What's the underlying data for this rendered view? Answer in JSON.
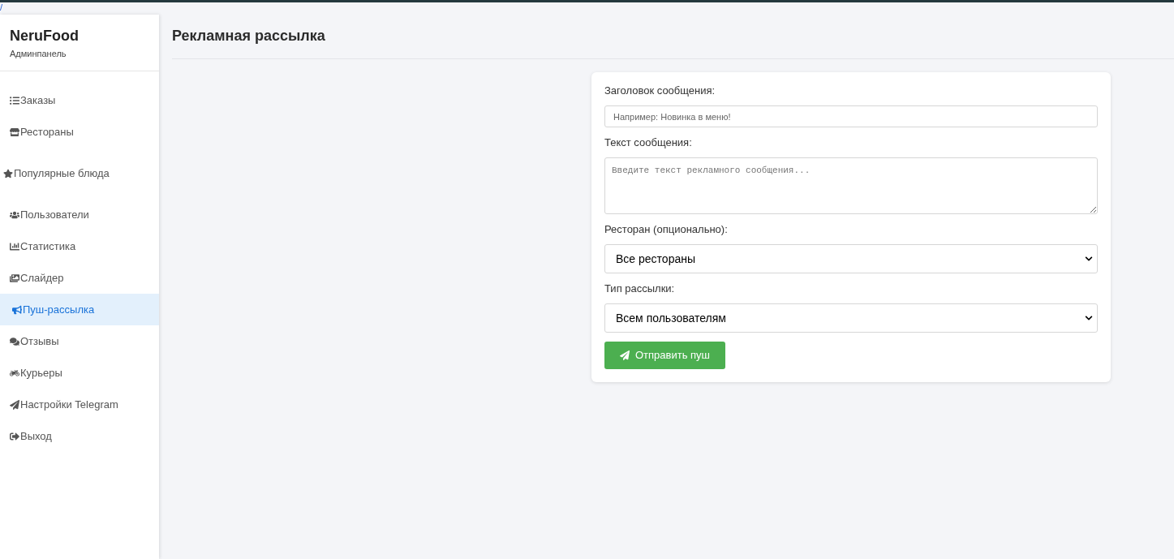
{
  "top_fragment": "/",
  "sidebar": {
    "brand": "NeruFood",
    "subtitle": "Админпанель",
    "items": [
      {
        "label": "Заказы",
        "kind": "nav",
        "selected": false
      },
      {
        "label": "Рестораны",
        "kind": "nav",
        "selected": false
      },
      {
        "label": "Популярные блюда",
        "kind": "block",
        "selected": false
      },
      {
        "label": "Пользователи",
        "kind": "nav",
        "selected": false
      },
      {
        "label": "Статистика",
        "kind": "nav",
        "selected": false
      },
      {
        "label": "Слайдер",
        "kind": "nav",
        "selected": false
      },
      {
        "label": "Пуш-рассылка",
        "kind": "nav",
        "selected": true
      },
      {
        "label": "Отзывы",
        "kind": "nav",
        "selected": false
      },
      {
        "label": "Курьеры",
        "kind": "nav",
        "selected": false
      },
      {
        "label": "Настройки Telegram",
        "kind": "nav",
        "selected": false
      },
      {
        "label": "Выход",
        "kind": "nav",
        "selected": false
      }
    ]
  },
  "page": {
    "title": "Рекламная рассылка"
  },
  "form": {
    "fields": [
      {
        "label": "Заголовок сообщения:",
        "kind": "input",
        "placeholder": "Например: Новинка в меню!"
      },
      {
        "label": "Текст сообщения:",
        "kind": "textarea",
        "placeholder": "Введите текст рекламного сообщения..."
      },
      {
        "label": "Ресторан (опционально):",
        "kind": "select",
        "value": "Все рестораны"
      },
      {
        "label": "Тип рассылки:",
        "kind": "select",
        "value": "Всем пользователям"
      }
    ],
    "submit": "Отправить пуш"
  }
}
